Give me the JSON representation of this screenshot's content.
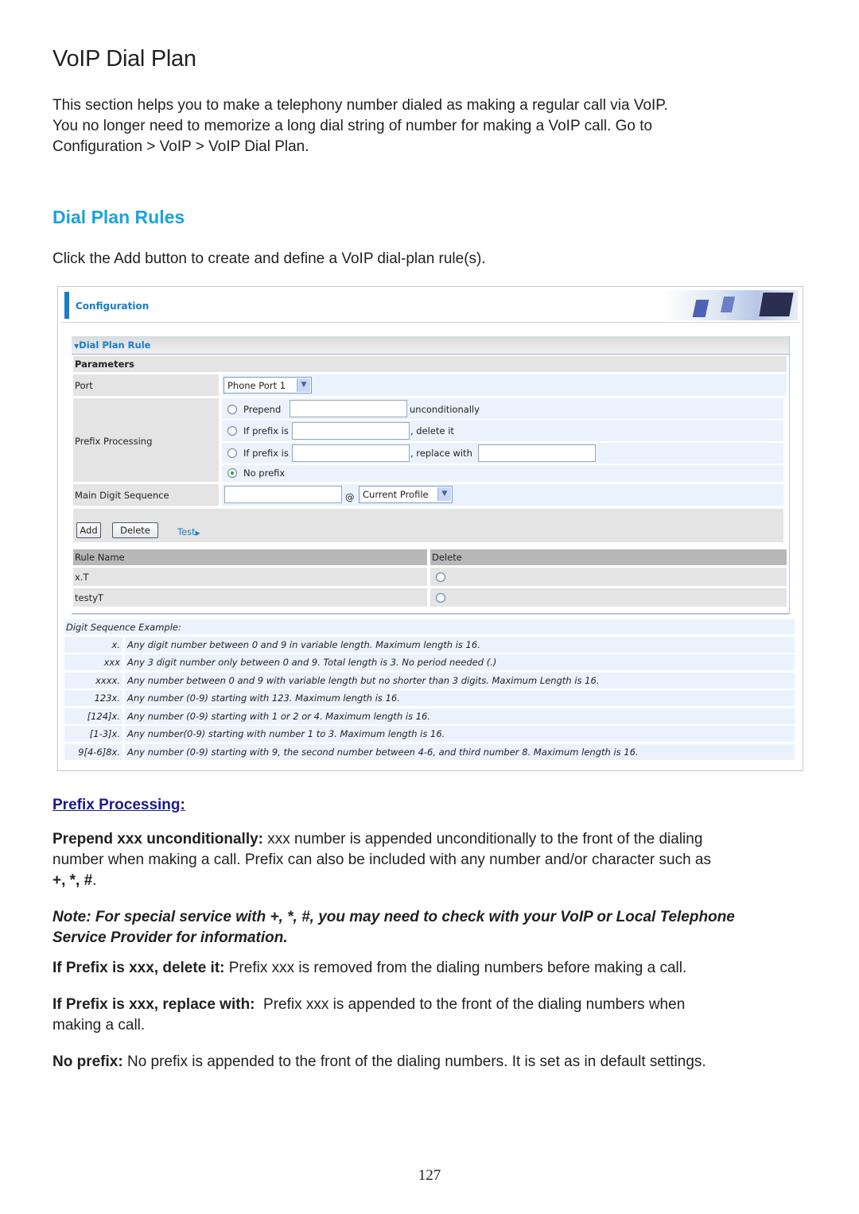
{
  "page": {
    "title": "VoIP Dial Plan",
    "intro_lines": [
      "This section helps you to make a telephony number dialed as making a regular call via VoIP.",
      "You no longer need to memorize a long dial string of number for making a VoIP call. Go to",
      "Configuration > VoIP > VoIP Dial Plan."
    ],
    "section_title": "Dial Plan Rules",
    "section_intro": "Click the Add button to create and define a VoIP dial-plan rule(s).",
    "page_number": "127"
  },
  "screenshot": {
    "header_title": "Configuration",
    "panel_title": "Dial Plan Rule",
    "params_label": "Parameters",
    "port": {
      "label": "Port",
      "value": "Phone Port 1"
    },
    "prefix_processing": {
      "label": "Prefix Processing",
      "options": [
        {
          "label": "Prepend",
          "suffix": "unconditionally",
          "selected": false,
          "value": ""
        },
        {
          "label": "If prefix is",
          "suffix": ", delete it",
          "selected": false,
          "value": ""
        },
        {
          "label": "If prefix is",
          "suffix": ", replace with",
          "selected": false,
          "value": "",
          "replace_value": ""
        },
        {
          "label": "No prefix",
          "selected": true
        }
      ]
    },
    "main_digit_sequence": {
      "label": "Main Digit Sequence",
      "value": "",
      "at": "@",
      "profile": "Current Profile"
    },
    "buttons": {
      "add": "Add",
      "delete": "Delete",
      "test": "Test"
    },
    "rules_table": {
      "headers": [
        "Rule Name",
        "Delete"
      ],
      "rows": [
        {
          "name": "x.T",
          "delete_selected": false
        },
        {
          "name": "testyT",
          "delete_selected": false
        }
      ]
    },
    "examples": {
      "title": "Digit Sequence Example:",
      "rows": [
        {
          "pattern": "x.",
          "desc": "Any digit number between 0 and 9 in variable length. Maximum length is 16."
        },
        {
          "pattern": "xxx",
          "desc": "Any 3 digit number only between 0 and 9. Total length is 3. No period needed (.)"
        },
        {
          "pattern": "xxxx.",
          "desc": "Any number between 0 and 9 with variable length but no shorter than 3 digits. Maximum Length is 16."
        },
        {
          "pattern": "123x.",
          "desc": "Any number (0-9) starting with 123. Maximum length is 16."
        },
        {
          "pattern": "[124]x.",
          "desc": "Any number (0-9) starting with 1 or 2 or 4. Maximum length is 16."
        },
        {
          "pattern": "[1-3]x.",
          "desc": "Any number(0-9) starting with number 1 to 3. Maximum length is 16."
        },
        {
          "pattern": "9[4-6]8x.",
          "desc": "Any number (0-9) starting with 9, the second number between 4-6, and third number 8. Maximum length is 16."
        }
      ]
    }
  },
  "explanations": {
    "heading": "Prefix Processing:",
    "prepend": {
      "term": "Prepend xxx unconditionally:",
      "text": " xxx number is appended unconditionally to the front of the dialing",
      "text2": "number when making a call. Prefix can also be included with any number and/or character such as",
      "chars": "+, *, #",
      "end": "."
    },
    "note_line1": "Note: For special service with +, *, #, you may need to check with your VoIP or Local Telephone",
    "note_line2": "Service Provider for information.",
    "delete": {
      "term": "If Prefix is xxx, delete it:",
      "text": " Prefix xxx is removed from the dialing numbers before making a call."
    },
    "replace": {
      "term": "If Prefix is xxx, replace with:",
      "text": "  Prefix xxx is appended to the front of the dialing numbers when",
      "text2": "making a call."
    },
    "noprefix": {
      "term": "No prefix:",
      "text": " No prefix is appended to the front of the dialing numbers. It is set as in default settings."
    }
  }
}
